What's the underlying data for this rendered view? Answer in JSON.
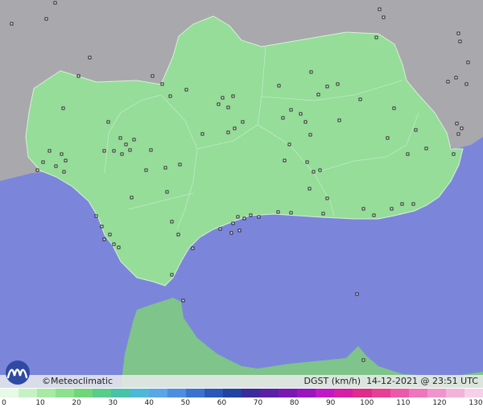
{
  "map": {
    "sea_color": "#7b86da",
    "land_color": "#95dd99",
    "outside_color": "#a9a9ad",
    "moroccan_coast_color": "#7fc48a"
  },
  "footer": {
    "brand": "©Meteoclimatic",
    "caption": "DGST (km/h)  14-12-2021 @ 23:51 UTC"
  },
  "legend": {
    "labels": [
      "0",
      "10",
      "20",
      "30",
      "40",
      "50",
      "60",
      "70",
      "80",
      "90",
      "100",
      "110",
      "120",
      "130"
    ],
    "colors": [
      "#e6fae6",
      "#c5f2c5",
      "#a6eaa6",
      "#8de08d",
      "#6fd67a",
      "#58cc8a",
      "#48c2a8",
      "#4eb8d8",
      "#5aa6e8",
      "#4e8ee0",
      "#3a72d0",
      "#2a58b8",
      "#2044a0",
      "#3a2a9c",
      "#5a20a8",
      "#7a18b4",
      "#9a14c0",
      "#c018c4",
      "#d41ea8",
      "#e02a8c",
      "#e64094",
      "#ea5aa8",
      "#ee76bc",
      "#f094cc",
      "#f2b2da",
      "#f6d0e8"
    ]
  }
}
